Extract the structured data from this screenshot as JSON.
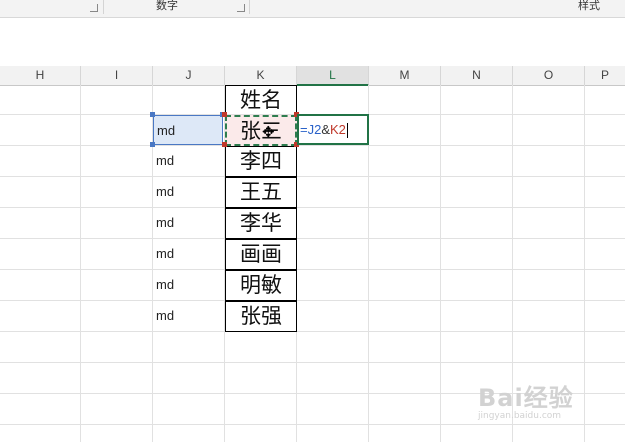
{
  "ribbon": {
    "group_number": "数字",
    "group_styles": "样式"
  },
  "columns": [
    "H",
    "I",
    "J",
    "K",
    "L",
    "M",
    "N",
    "O",
    "P"
  ],
  "active_column": "L",
  "k_column": [
    "姓名",
    "张三",
    "李四",
    "王五",
    "李华",
    "画画",
    "明敏",
    "张强"
  ],
  "j_column": [
    "md",
    "md",
    "md",
    "md",
    "md",
    "md",
    "md"
  ],
  "editing_cell": {
    "formula_part1": "=J2",
    "formula_part2": "&",
    "formula_part3": "K2"
  },
  "colors": {
    "accent": "#217346",
    "ref_j": "#4a78c4",
    "ref_k": "#c0392b"
  },
  "watermark": {
    "text": "Bai经验",
    "sub": "jingyan.baidu.com"
  }
}
